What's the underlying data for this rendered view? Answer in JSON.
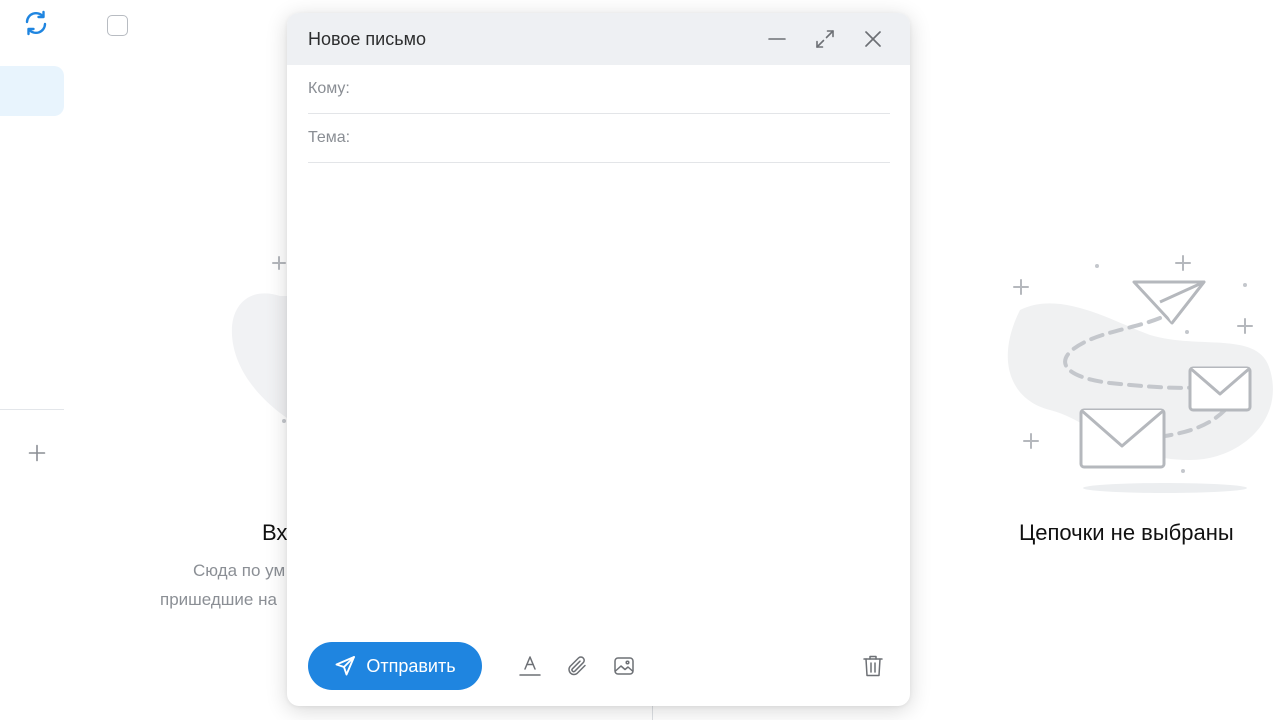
{
  "compose": {
    "title": "Новое письмо",
    "to_label": "Кому:",
    "subject_label": "Тема:",
    "send_label": "Отправить"
  },
  "inbox_empty": {
    "title": "Вх",
    "line1": "Сюда по ум",
    "line2": "пришедшие на"
  },
  "threads_empty": {
    "title": "Цепочки не выбраны"
  },
  "icons": {
    "refresh": "refresh-icon",
    "add_folder": "plus-icon",
    "minimize": "minimize-icon",
    "expand": "expand-icon",
    "close": "close-icon",
    "send": "paper-plane-icon",
    "text_format": "text-format-icon",
    "attach": "paperclip-icon",
    "image": "image-icon",
    "delete": "trash-icon"
  },
  "colors": {
    "accent": "#1f85e0",
    "active_folder_bg": "#e8f4fd",
    "header_bg": "#eef0f3"
  }
}
